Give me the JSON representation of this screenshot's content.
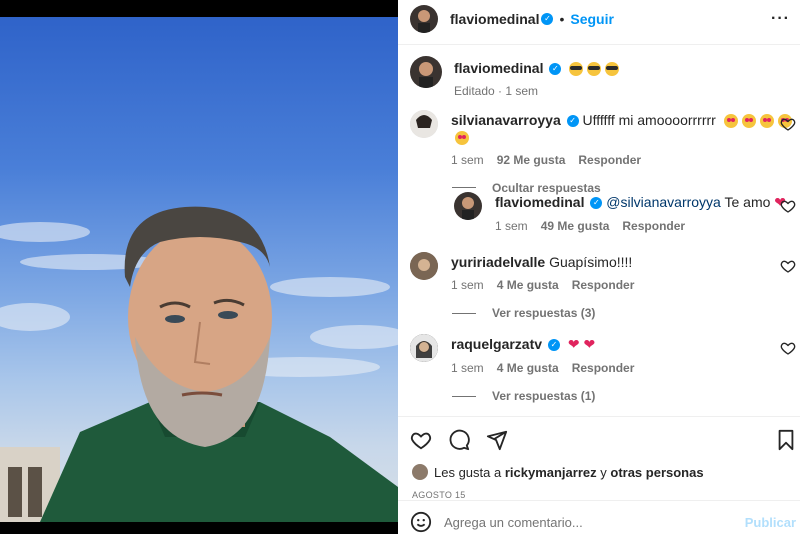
{
  "header": {
    "username": "flaviomedinal",
    "follow": "Seguir",
    "dot": "•"
  },
  "caption": {
    "username": "flaviomedinal",
    "meta": "Editado · 1 sem"
  },
  "comments": [
    {
      "username": "silvianavarroyya",
      "text": "Uffffff mi amoooorrrrrr",
      "time": "1 sem",
      "likes": "92 Me gusta",
      "reply": "Responder",
      "thread_label": "Ocultar respuestas"
    },
    {
      "username": "flaviomedinal",
      "mention": "@silvianavarroyya",
      "text": "Te amo",
      "time": "1 sem",
      "likes": "49 Me gusta",
      "reply": "Responder"
    },
    {
      "username": "yuririadelvalle",
      "text": "Guapísimo!!!!",
      "time": "1 sem",
      "likes": "4 Me gusta",
      "reply": "Responder",
      "thread_label": "Ver respuestas (3)"
    },
    {
      "username": "raquelgarzatv",
      "text": "",
      "time": "1 sem",
      "likes": "4 Me gusta",
      "reply": "Responder",
      "thread_label": "Ver respuestas (1)"
    }
  ],
  "likes": {
    "prefix": "Les gusta a",
    "user": "rickymanjarrez",
    "joiner": "y",
    "others": "otras personas"
  },
  "date": "AGOSTO 15",
  "comment_box": {
    "placeholder": "Agrega un comentario...",
    "post": "Publicar"
  },
  "colors": {
    "accent": "#0095f6",
    "verified": "#0095f6"
  },
  "icons": [
    "more-icon",
    "heart-icon",
    "comment-icon",
    "share-icon",
    "bookmark-icon",
    "emoji-icon"
  ]
}
